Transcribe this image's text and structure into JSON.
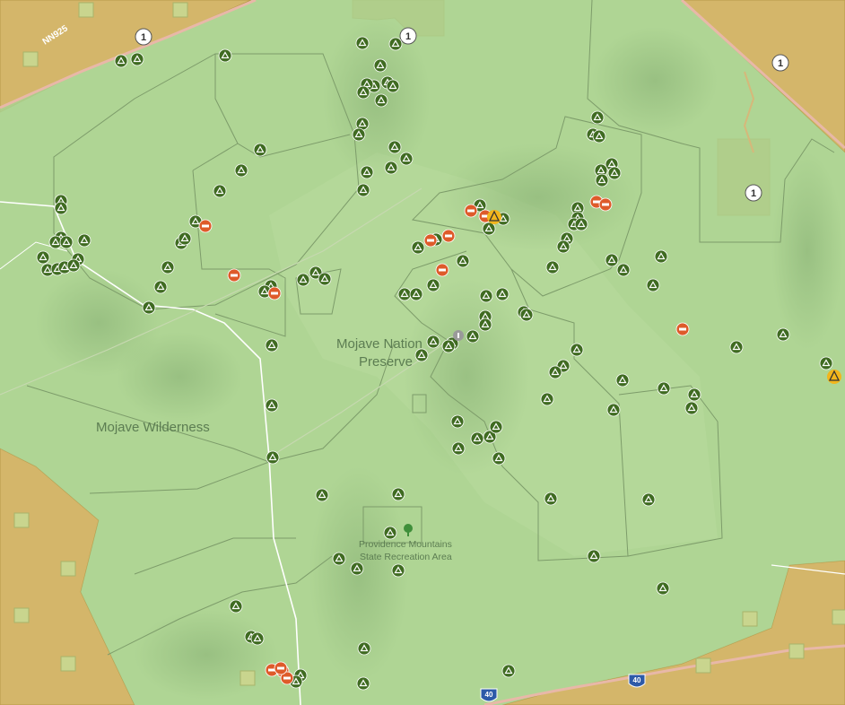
{
  "map": {
    "labels": {
      "preserve": [
        "Mojave Nation",
        "Preserve"
      ],
      "wilderness": "Mojave Wilderness",
      "state_area": [
        "Providence Mountains",
        "State Recreation Area"
      ],
      "road_nn925": "NN925"
    },
    "route_shields": [
      {
        "text": "1"
      },
      {
        "text": "1"
      },
      {
        "text": "1"
      },
      {
        "text": "1"
      }
    ],
    "interstate_shields": [
      {
        "text": "40"
      },
      {
        "text": "40"
      }
    ],
    "icons": {
      "campsite": "campsite-icon",
      "viewpoint": "viewpoint-icon",
      "warning": "warning-icon",
      "info": "info-icon",
      "tree": "tree-icon"
    },
    "colors": {
      "preserve_fill": "#a9d290",
      "blm_land": "#d4b66a",
      "campsite": "#3f6b21",
      "poi_orange": "#de5b2a",
      "warning": "#f2b51c",
      "road_primary": "#e8b8a8",
      "text_green": "#5c7d52"
    }
  }
}
